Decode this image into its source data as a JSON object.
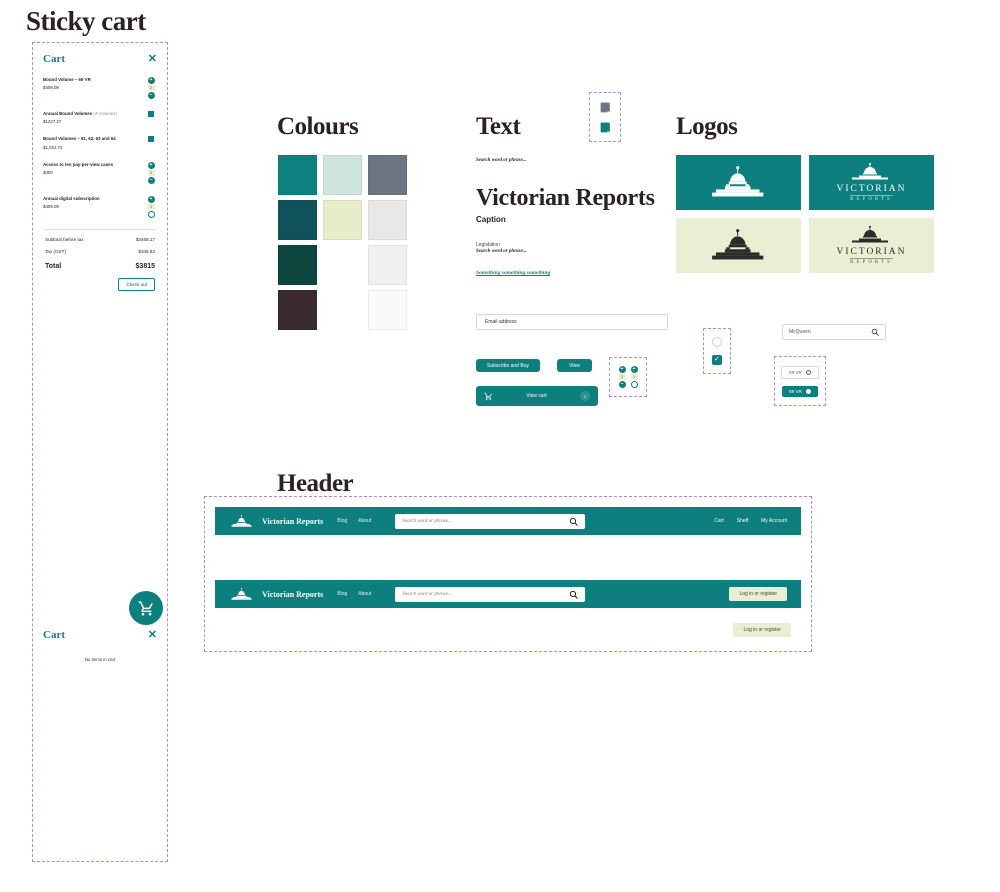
{
  "sections": {
    "sticky_cart": "Sticky cart",
    "colours": "Colours",
    "text": "Text",
    "logos": "Logos",
    "header": "Header"
  },
  "cart": {
    "title": "Cart",
    "close_icon": "close-icon",
    "items": [
      {
        "name": "Bound Volume – 69 VR",
        "sub": "",
        "price": "$409.09",
        "control": "stepper",
        "qty": "2"
      },
      {
        "name": "Annual Bound Volumes ",
        "sub": "(4 Volumes)",
        "price": "$1227.27",
        "control": "remove",
        "qty": ""
      },
      {
        "name": "Bound Volumes – 61, 62, 63 and 64",
        "sub": "",
        "price": "$1,022.72",
        "control": "remove",
        "qty": ""
      },
      {
        "name": "Access to ten pay-per-view cases",
        "sub": "",
        "price": "$400",
        "control": "stepper",
        "qty": "2"
      },
      {
        "name": "Annual digital subscription",
        "sub": "",
        "price": "$409.09",
        "control": "stepper-outline",
        "qty": "1"
      }
    ],
    "totals": [
      {
        "label": "Subtotal before tax",
        "value": "$3468.17"
      },
      {
        "label": "Tax (GST)",
        "value": "$346.83"
      }
    ],
    "total_label": "Total",
    "total_value": "$3815",
    "checkout_label": "Check out",
    "empty_title": "Cart",
    "empty_message": "No items in cart",
    "fab_icon": "shopping-cart-icon",
    "plus_label": "+",
    "minus_label": "–"
  },
  "colour_swatches": [
    [
      "#0d8080",
      "#cde5dd",
      "#6b7682"
    ],
    [
      "#10535a",
      "#e9ecc8",
      "#e8e8e8"
    ],
    [
      "#0d463f",
      "",
      "#f0f0f0"
    ],
    [
      "#3b2b31",
      "",
      ""
    ]
  ],
  "text_samples": {
    "search_italic": "Search word or phrase...",
    "heading": "Victorian Reports",
    "caption": "Caption",
    "legislation_label": "Legislation",
    "legislation_search": "Search word or phrase...",
    "link": "Something something something"
  },
  "form": {
    "email_placeholder": "Email address",
    "subscribe_label": "Subscribe and Buy",
    "view_label": "View",
    "view_cart_label": "View cart",
    "view_cart_badge": "0",
    "cart_icon": "shopping-cart-icon",
    "search_value": "McQueen",
    "search_icon": "search-icon",
    "check_icon": "check-icon",
    "chip_ghost_label": "69 VR",
    "chip_solid_label": "69 VR",
    "stepper_qty_left": "2",
    "stepper_qty_right": "1"
  },
  "logos": {
    "wordmark_top": "VICTORIAN",
    "wordmark_bottom": "REPORTS",
    "tiles": [
      {
        "bg": "teal",
        "style": "mark-only"
      },
      {
        "bg": "teal",
        "style": "mark-and-wordmark"
      },
      {
        "bg": "cream",
        "style": "mark-only"
      },
      {
        "bg": "cream",
        "style": "mark-and-wordmark"
      }
    ]
  },
  "header_bars": [
    {
      "brand": "Victorian Reports",
      "nav": [
        "Blog",
        "About"
      ],
      "search_placeholder": "Search word or phrase...",
      "right_links": [
        "Cart",
        "Shelf",
        "My Account"
      ],
      "login_label": ""
    },
    {
      "brand": "Victorian Reports",
      "nav": [
        "Blog",
        "About"
      ],
      "search_placeholder": "Search word or phrase...",
      "right_links": [],
      "login_label": "Log in or register"
    }
  ],
  "loose_login_label": "Log in or register",
  "colors": {
    "teal": "#0d7f7f",
    "dark_teal": "#10535a",
    "deep_green": "#0d463f",
    "plum": "#3b2b31",
    "mint": "#cde5dd",
    "cream": "#eaeed2",
    "slate": "#6b7682",
    "dashed_outline": "#a98fd6"
  }
}
